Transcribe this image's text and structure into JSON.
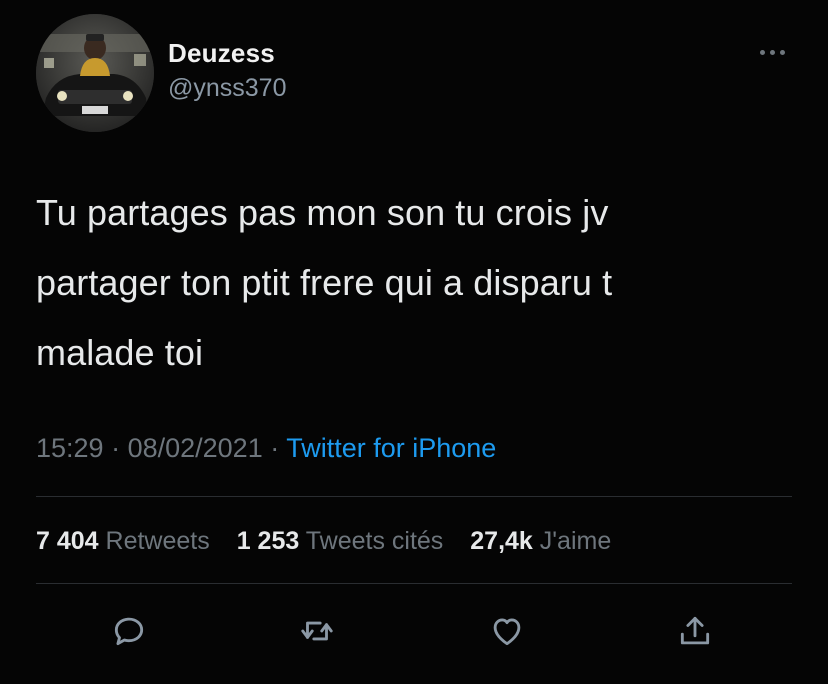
{
  "tweet": {
    "author": {
      "display_name": "Deuzess",
      "handle": "@ynss370",
      "avatar_icon": "profile-photo"
    },
    "more_icon": "more-horizontal-icon",
    "text": "Tu partages pas mon son tu crois jv\npartager ton ptit frere qui a disparu t\nmalade toi",
    "time": "15:29",
    "date": "08/02/2021",
    "separator": " · ",
    "source": "Twitter for iPhone",
    "stats": {
      "retweets_count": "7 404",
      "retweets_label": "Retweets",
      "quotes_count": "1 253",
      "quotes_label": "Tweets cités",
      "likes_count": "27,4k",
      "likes_label": "J'aime"
    },
    "actions": {
      "reply_icon": "reply-icon",
      "retweet_icon": "retweet-icon",
      "like_icon": "heart-icon",
      "share_icon": "share-icon"
    }
  },
  "colors": {
    "background": "#050505",
    "text": "#e7e9ea",
    "secondary": "#6e767d",
    "link": "#1d9bf0",
    "divider": "#2a2d31"
  }
}
